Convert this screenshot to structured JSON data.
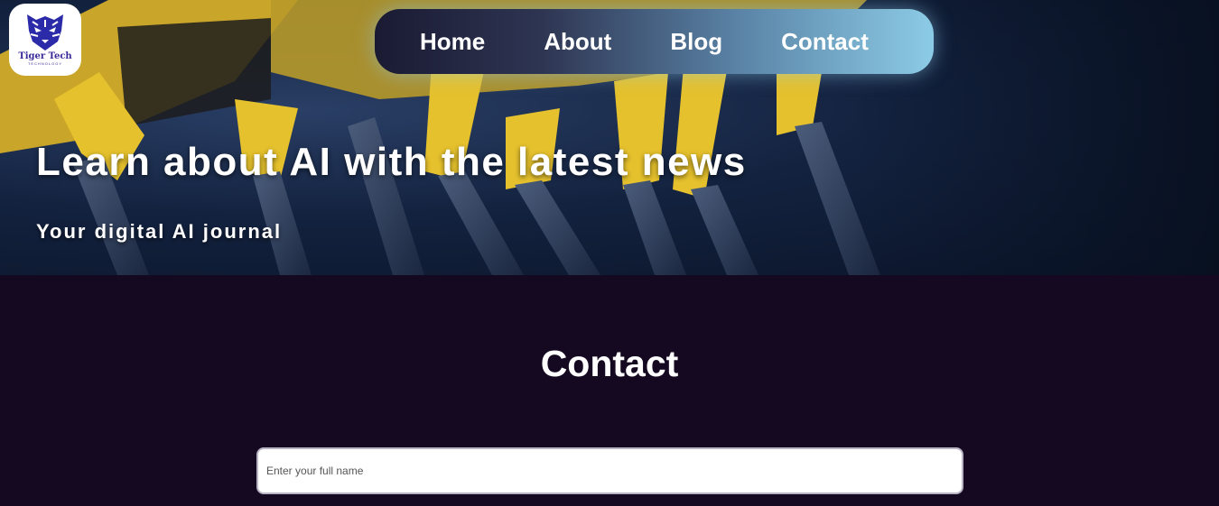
{
  "logo": {
    "name": "Tiger Tech",
    "tagline": "TECHNOLOGY"
  },
  "nav": {
    "items": [
      {
        "label": "Home"
      },
      {
        "label": "About"
      },
      {
        "label": "Blog"
      },
      {
        "label": "Contact"
      }
    ]
  },
  "hero": {
    "title": "Learn about AI with the latest news",
    "subtitle": "Your digital AI journal"
  },
  "contact": {
    "heading": "Contact",
    "name_placeholder": "Enter your full name"
  },
  "colors": {
    "page_background": "#150821",
    "hero_dark": "#0a1428",
    "robot_yellow": "#e5c12d",
    "nav_gradient_start": "#1a1a33",
    "nav_gradient_end": "#8ccbe6"
  }
}
